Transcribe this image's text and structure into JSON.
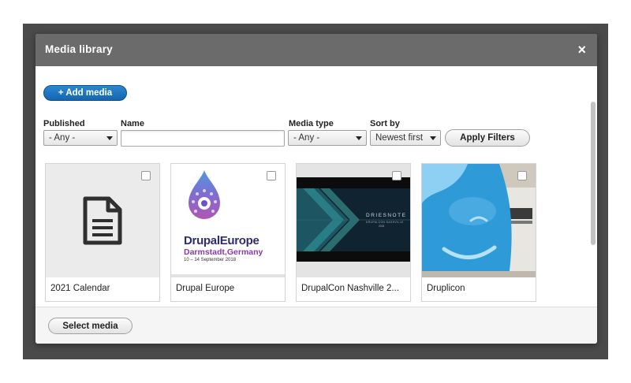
{
  "dialog": {
    "title": "Media library",
    "close_glyph": "×"
  },
  "toolbar": {
    "add_media_label": "+ Add media"
  },
  "filters": {
    "published": {
      "label": "Published",
      "value": "- Any -"
    },
    "name": {
      "label": "Name",
      "value": ""
    },
    "media_type": {
      "label": "Media type",
      "value": "- Any -"
    },
    "sort_by": {
      "label": "Sort by",
      "value": "Newest first"
    },
    "apply_label": "Apply Filters"
  },
  "media_items": [
    {
      "label": "2021 Calendar",
      "thumb": "document-icon"
    },
    {
      "label": "Drupal Europe",
      "thumb": "drupal-europe-logo",
      "logo_title": "DrupalEurope",
      "logo_city": "Darmstadt,Germany",
      "logo_dates": "10 – 14 September 2018"
    },
    {
      "label": "DrupalCon Nashville 2...",
      "thumb": "driesnote-slide",
      "slide_title": "DRIESNOTE",
      "slide_subtitle": "DRUPALCON NASHVILLE",
      "slide_year": "2018"
    },
    {
      "label": "Druplicon",
      "thumb": "druplicon-photo"
    }
  ],
  "footer": {
    "select_media_label": "Select media"
  },
  "colors": {
    "primary": "#1b72bf",
    "titlebar": "#6b6b6b",
    "overlay": "#4a4a4a"
  }
}
